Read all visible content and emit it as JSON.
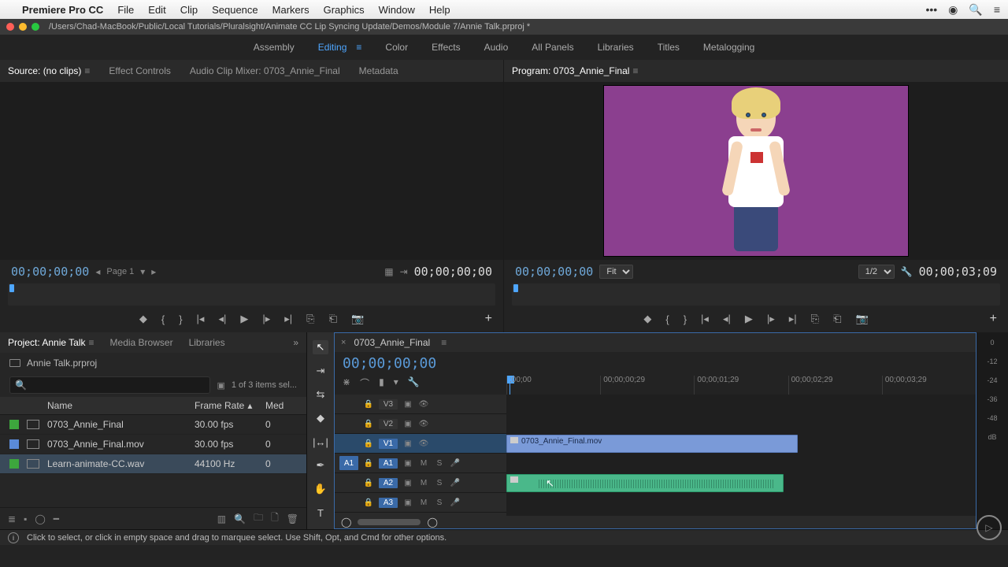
{
  "menubar": {
    "app": "Premiere Pro CC",
    "items": [
      "File",
      "Edit",
      "Clip",
      "Sequence",
      "Markers",
      "Graphics",
      "Window",
      "Help"
    ]
  },
  "titlebar": {
    "path": "/Users/Chad-MacBook/Public/Local Tutorials/Pluralsight/Animate CC Lip Syncing Update/Demos/Module 7/Annie Talk.prproj *"
  },
  "workspaces": {
    "items": [
      "Assembly",
      "Editing",
      "Color",
      "Effects",
      "Audio",
      "All Panels",
      "Libraries",
      "Titles",
      "Metalogging"
    ],
    "active": "Editing"
  },
  "source": {
    "tabs": {
      "source": "Source: (no clips)",
      "effect_controls": "Effect Controls",
      "mixer": "Audio Clip Mixer: 0703_Annie_Final",
      "metadata": "Metadata"
    },
    "timecode_left": "00;00;00;00",
    "page": "Page 1",
    "timecode_right": "00;00;00;00"
  },
  "program": {
    "tab": "Program: 0703_Annie_Final",
    "timecode_left": "00;00;00;00",
    "zoom": "Fit",
    "res": "1/2",
    "timecode_right": "00;00;03;09"
  },
  "project": {
    "tabs": {
      "project": "Project: Annie Talk",
      "media": "Media Browser",
      "libraries": "Libraries"
    },
    "file": "Annie Talk.prproj",
    "items_count": "1 of 3 items sel...",
    "columns": {
      "name": "Name",
      "fps": "Frame Rate",
      "med": "Med"
    },
    "rows": [
      {
        "swatch": "g",
        "name": "0703_Annie_Final",
        "fps": "30.00 fps",
        "med": "0"
      },
      {
        "swatch": "b",
        "name": "0703_Annie_Final.mov",
        "fps": "30.00 fps",
        "med": "0"
      },
      {
        "swatch": "g",
        "name": "Learn-animate-CC.wav",
        "fps": "44100 Hz",
        "med": "0",
        "selected": true
      }
    ]
  },
  "timeline": {
    "tab": "0703_Annie_Final",
    "timecode": "00;00;00;00",
    "ticks": [
      ";00;00",
      "00;00;00;29",
      "00;00;01;29",
      "00;00;02;29",
      "00;00;03;29"
    ],
    "tracks": {
      "v3": "V3",
      "v2": "V2",
      "v1": "V1",
      "a1": "A1",
      "a2": "A2",
      "a3": "A3",
      "src_a1": "A1"
    },
    "clips": {
      "video": "0703_Annie_Final.mov"
    }
  },
  "meter": {
    "labels": [
      "0",
      "-12",
      "-24",
      "-36",
      "-48",
      "dB"
    ]
  },
  "status": {
    "text": "Click to select, or click in empty space and drag to marquee select. Use Shift, Opt, and Cmd for other options."
  }
}
